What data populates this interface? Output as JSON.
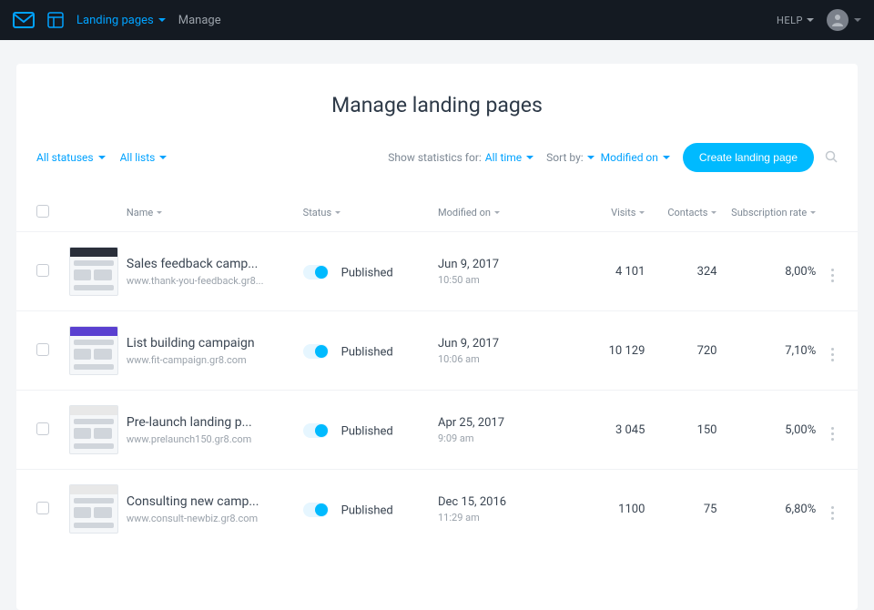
{
  "nav": {
    "landing_pages": "Landing pages",
    "manage": "Manage",
    "help": "HELP"
  },
  "page_title": "Manage landing pages",
  "filters": {
    "all_statuses": "All statuses",
    "all_lists": "All lists",
    "show_stats_label": "Show statistics for:",
    "all_time": "All time",
    "sort_label": "Sort by:",
    "modified_on": "Modified on",
    "cta": "Create landing page"
  },
  "columns": {
    "name": "Name",
    "status": "Status",
    "modified_on": "Modified on",
    "visits": "Visits",
    "contacts": "Contacts",
    "subscription_rate": "Subscription rate"
  },
  "rows": [
    {
      "name": "Sales feedback camp...",
      "url": "www.thank-you-feedback.gr8...",
      "status": "Published",
      "date": "Jun 9, 2017",
      "time": "10:50 am",
      "visits": "4 101",
      "contacts": "324",
      "sub": "8,00%",
      "thumb": "t1"
    },
    {
      "name": "List building campaign",
      "url": "www.fit-campaign.gr8.com",
      "status": "Published",
      "date": "Jun 9, 2017",
      "time": "10:06 am",
      "visits": "10 129",
      "contacts": "720",
      "sub": "7,10%",
      "thumb": "t2"
    },
    {
      "name": "Pre-launch landing p...",
      "url": "www.prelaunch150.gr8.com",
      "status": "Published",
      "date": "Apr 25, 2017",
      "time": "9:09 am",
      "visits": "3 045",
      "contacts": "150",
      "sub": "5,00%",
      "thumb": "t3"
    },
    {
      "name": "Consulting new camp...",
      "url": "www.consult-newbiz.gr8.com",
      "status": "Published",
      "date": "Dec 15, 2016",
      "time": "11:29 am",
      "visits": "1100",
      "contacts": "75",
      "sub": "6,80%",
      "thumb": "t4"
    }
  ]
}
